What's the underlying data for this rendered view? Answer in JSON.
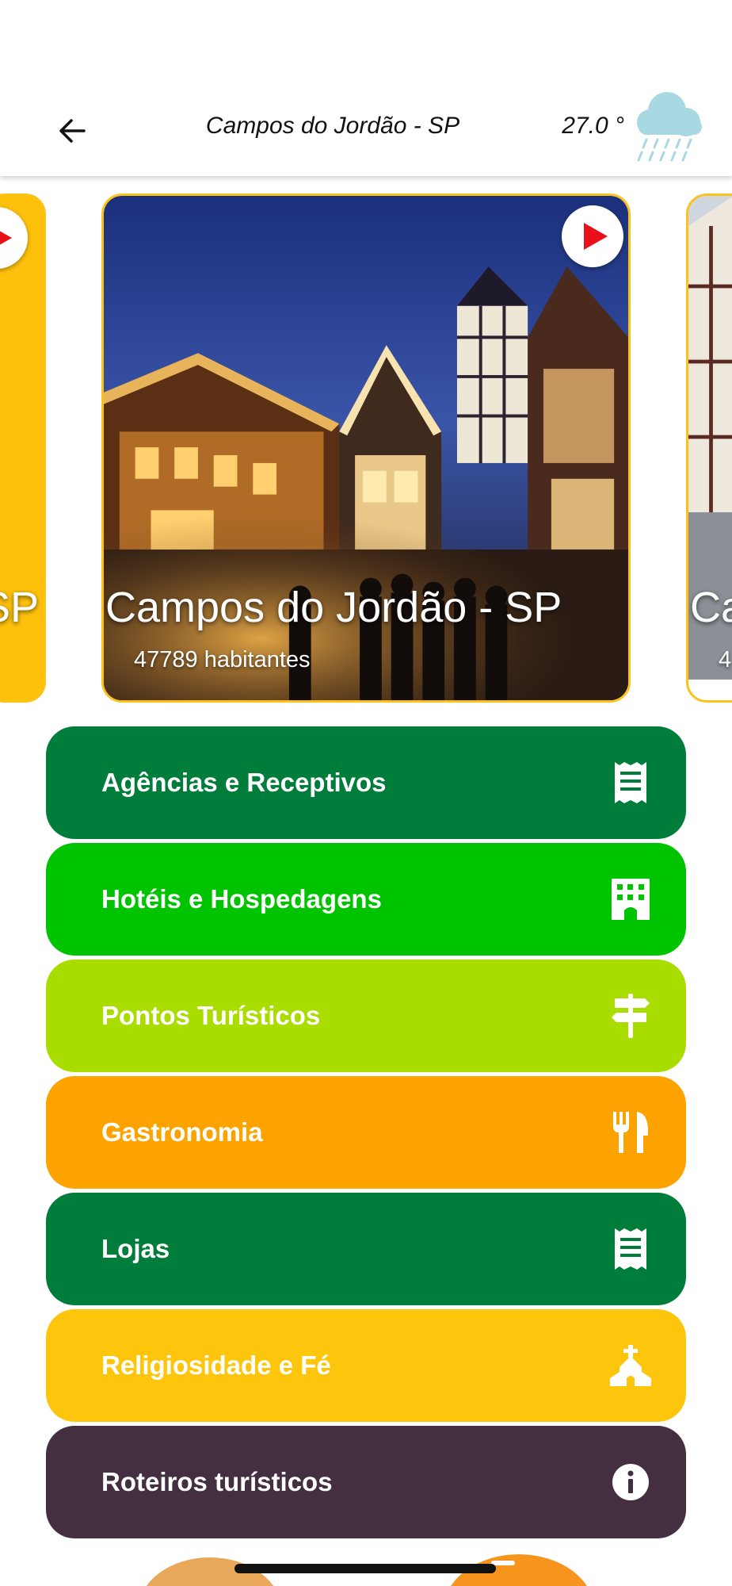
{
  "header": {
    "title": "Campos do Jordão - SP",
    "temperature": "27.0 °",
    "weather_icon": "rain-cloud-icon"
  },
  "carousel": {
    "prev_card": {
      "title_fragment": "SP"
    },
    "main_card": {
      "title": "Campos do Jordão - SP",
      "population": "47789 habitantes"
    },
    "next_card": {
      "title_fragment": "Ca",
      "population_fragment": "4"
    }
  },
  "menu": [
    {
      "label": "Agências e Receptivos",
      "color": "#007d3a",
      "icon": "receipt-icon"
    },
    {
      "label": "Hotéis e Hospedagens",
      "color": "#00c400",
      "icon": "building-icon"
    },
    {
      "label": "Pontos Turísticos",
      "color": "#a9dd00",
      "icon": "signpost-icon"
    },
    {
      "label": "Gastronomia",
      "color": "#fca300",
      "icon": "restaurant-icon"
    },
    {
      "label": "Lojas",
      "color": "#007d3a",
      "icon": "receipt-icon"
    },
    {
      "label": "Religiosidade e Fé",
      "color": "#fdc60c",
      "icon": "church-icon"
    },
    {
      "label": "Roteiros turísticos",
      "color": "#432f3f",
      "icon": "info-icon"
    }
  ],
  "colors": {
    "card_border": "#fbc21a",
    "play_red": "#e8101b"
  }
}
